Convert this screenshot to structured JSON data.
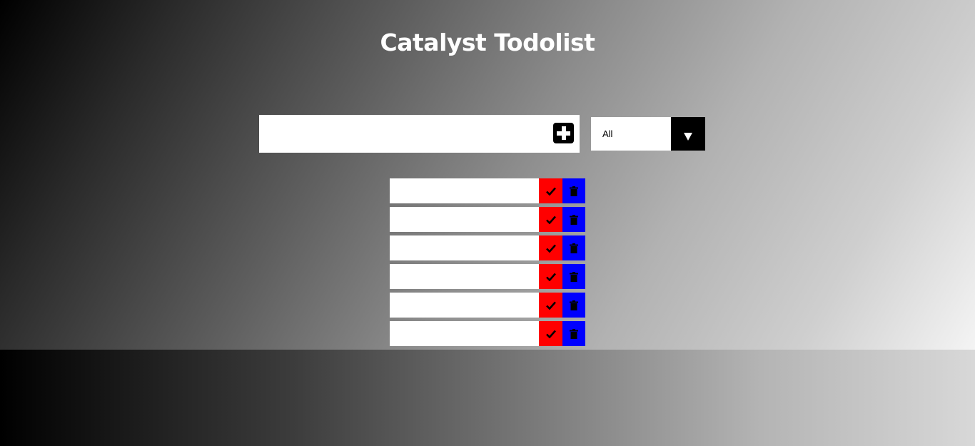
{
  "app": {
    "title": "Catalyst Todolist"
  },
  "form": {
    "input_value": "",
    "input_placeholder": "",
    "add_icon": "plus-square-icon"
  },
  "filter": {
    "selected": "All",
    "arrow_icon": "caret-down-icon"
  },
  "todos": [
    {
      "text": "",
      "complete_icon": "check-icon",
      "delete_icon": "trash-icon"
    },
    {
      "text": "",
      "complete_icon": "check-icon",
      "delete_icon": "trash-icon"
    },
    {
      "text": "",
      "complete_icon": "check-icon",
      "delete_icon": "trash-icon"
    },
    {
      "text": "",
      "complete_icon": "check-icon",
      "delete_icon": "trash-icon"
    },
    {
      "text": "",
      "complete_icon": "check-icon",
      "delete_icon": "trash-icon"
    },
    {
      "text": "",
      "complete_icon": "check-icon",
      "delete_icon": "trash-icon"
    }
  ],
  "colors": {
    "complete_button": "#ff0000",
    "delete_button": "#0000ff",
    "add_button": "#000000",
    "title_text": "#ffffff"
  }
}
